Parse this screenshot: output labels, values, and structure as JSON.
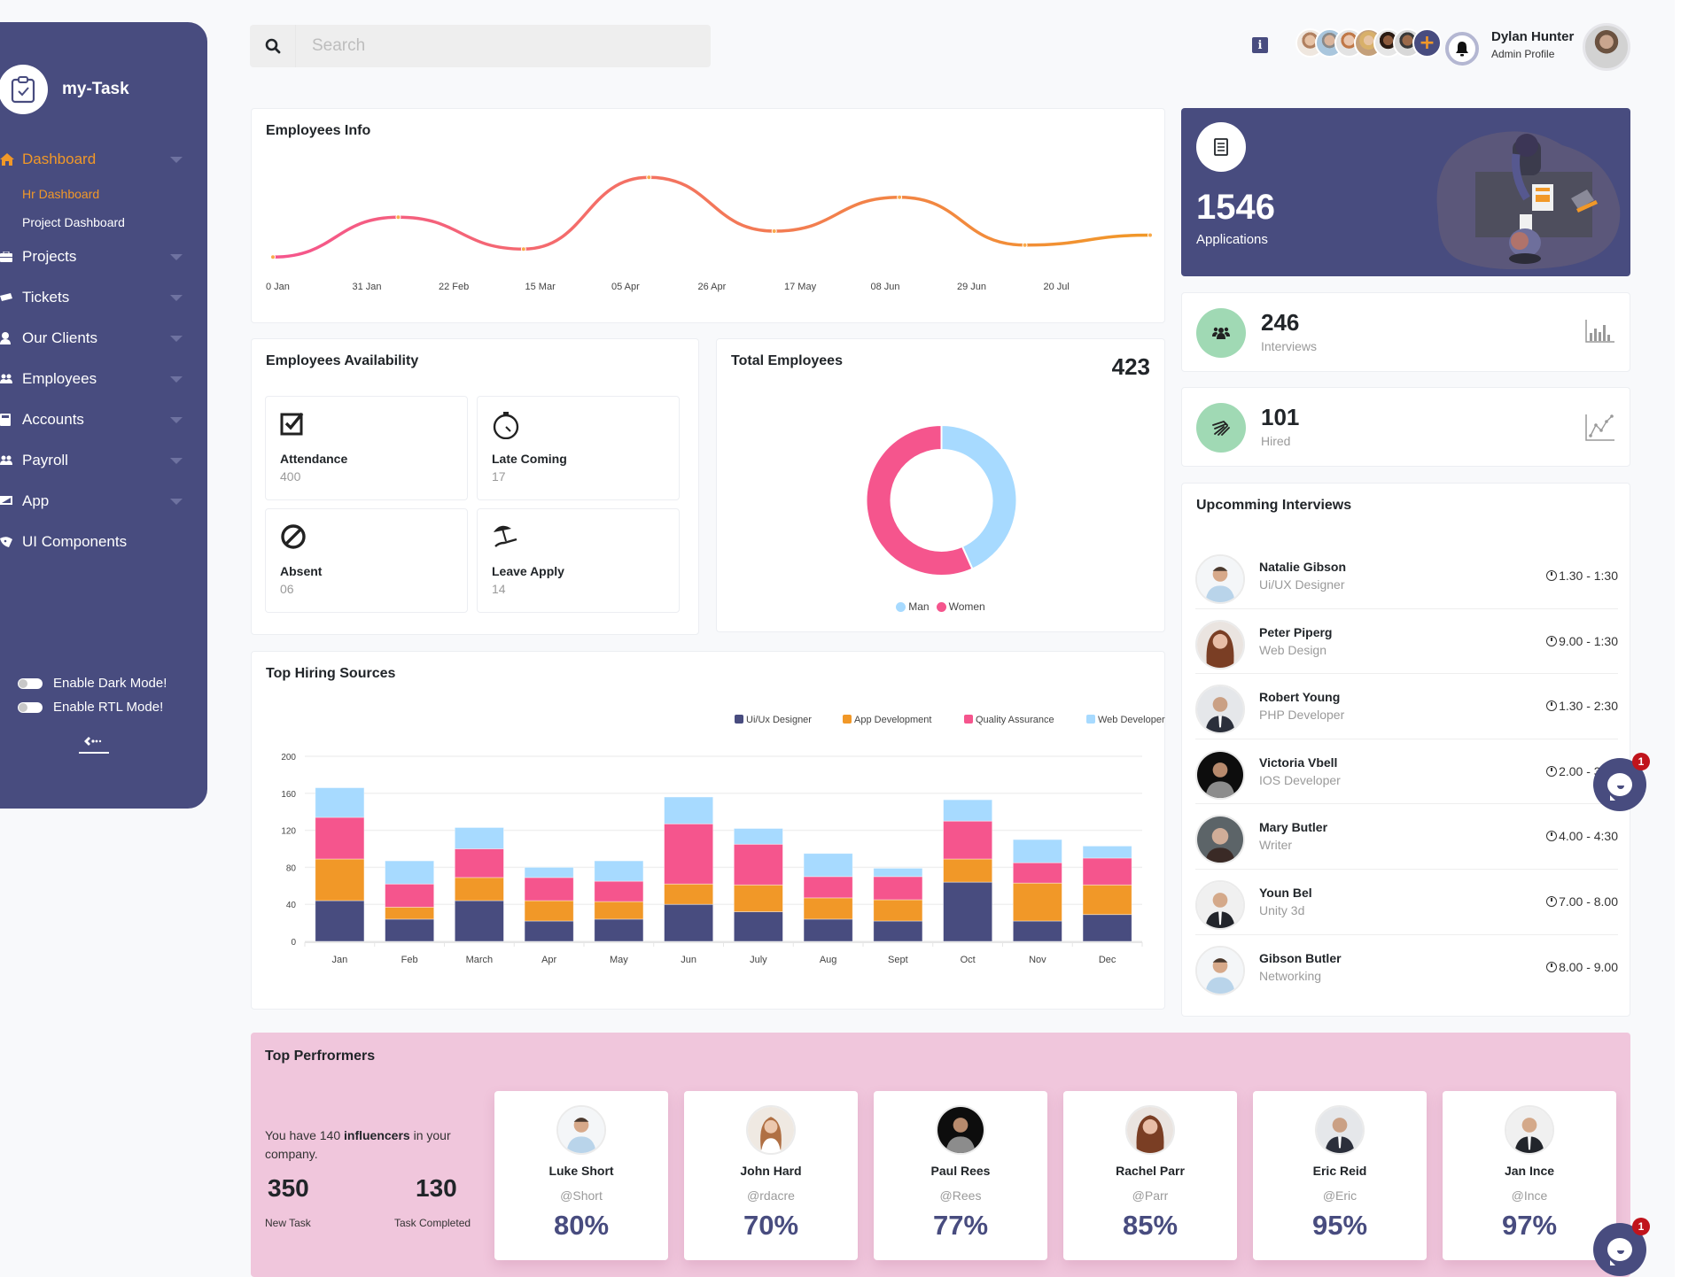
{
  "colors": {
    "primary": "#484c7f",
    "accent": "#f19828",
    "pink": "#f1c6dc",
    "green_circle": "#a0d9b4",
    "series": [
      "#484c7f",
      "#f19828",
      "#f5558d",
      "#a7daff"
    ]
  },
  "sidebar": {
    "brand": "my-Task",
    "brand_icon": "clipboard-check-icon",
    "menu": [
      {
        "label": "Dashboard",
        "icon": "home-icon",
        "active": true,
        "expandable": true,
        "children": [
          {
            "label": "Hr Dashboard",
            "active": true
          },
          {
            "label": "Project Dashboard",
            "active": false
          }
        ]
      },
      {
        "label": "Projects",
        "icon": "briefcase-icon",
        "expandable": true
      },
      {
        "label": "Tickets",
        "icon": "ticket-icon",
        "expandable": true
      },
      {
        "label": "Our Clients",
        "icon": "user-icon",
        "expandable": true
      },
      {
        "label": "Employees",
        "icon": "users-icon",
        "expandable": true
      },
      {
        "label": "Accounts",
        "icon": "calculator-icon",
        "expandable": true
      },
      {
        "label": "Payroll",
        "icon": "users-icon",
        "expandable": true
      },
      {
        "label": "App",
        "icon": "app-icon",
        "expandable": true
      },
      {
        "label": "UI Components",
        "icon": "palette-icon",
        "expandable": false
      }
    ],
    "toggles": [
      {
        "label": "Enable Dark Mode!",
        "on": false
      },
      {
        "label": "Enable RTL Mode!",
        "on": false
      }
    ],
    "collapse_icon": "arrow-left-icon"
  },
  "header": {
    "search": {
      "placeholder": "Search",
      "value": ""
    },
    "info_label": "i",
    "team_avatars": 6,
    "add_member_label": "+",
    "user": {
      "name": "Dylan Hunter",
      "role": "Admin Profile"
    }
  },
  "employees_info": {
    "title": "Employees Info"
  },
  "applications": {
    "value": "1546",
    "label": "Applications"
  },
  "stats": [
    {
      "value": "246",
      "label": "Interviews",
      "icon": "users-icon",
      "trend_icon": "bar-chart-icon"
    },
    {
      "value": "101",
      "label": "Hired",
      "icon": "handshake-icon",
      "trend_icon": "line-chart-icon"
    }
  ],
  "availability": {
    "title": "Employees Availability",
    "tiles": [
      {
        "label": "Attendance",
        "value": "400",
        "icon": "checkbox-icon"
      },
      {
        "label": "Late Coming",
        "value": "17",
        "icon": "stopwatch-icon"
      },
      {
        "label": "Absent",
        "value": "06",
        "icon": "ban-icon"
      },
      {
        "label": "Leave Apply",
        "value": "14",
        "icon": "beach-umbrella-icon"
      }
    ]
  },
  "total_employees": {
    "title": "Total Employees",
    "value": "423"
  },
  "top_hiring": {
    "title": "Top Hiring Sources"
  },
  "upcoming": {
    "title": "Upcomming Interviews",
    "items": [
      {
        "name": "Natalie Gibson",
        "role": "Ui/UX Designer",
        "time": "1.30 - 1:30"
      },
      {
        "name": "Peter Piperg",
        "role": "Web Design",
        "time": "9.00 - 1:30"
      },
      {
        "name": "Robert Young",
        "role": "PHP Developer",
        "time": "1.30 - 2:30"
      },
      {
        "name": "Victoria Vbell",
        "role": "IOS Developer",
        "time": "2.00 - 3:30"
      },
      {
        "name": "Mary Butler",
        "role": "Writer",
        "time": "4.00 - 4:30"
      },
      {
        "name": "Youn Bel",
        "role": "Unity 3d",
        "time": "7.00 - 8.00"
      },
      {
        "name": "Gibson Butler",
        "role": "Networking",
        "time": "8.00 - 9.00"
      }
    ]
  },
  "performers": {
    "title": "Top Perfrormers",
    "text_prefix": "You have 140 ",
    "text_bold": "influencers",
    "text_suffix": " in your company.",
    "new_task_value": "350",
    "new_task_label": "New Task",
    "completed_value": "130",
    "completed_label": "Task Completed",
    "people": [
      {
        "name": "Luke Short",
        "handle": "@Short",
        "pct": "80%"
      },
      {
        "name": "John Hard",
        "handle": "@rdacre",
        "pct": "70%"
      },
      {
        "name": "Paul Rees",
        "handle": "@Rees",
        "pct": "77%"
      },
      {
        "name": "Rachel Parr",
        "handle": "@Parr",
        "pct": "85%"
      },
      {
        "name": "Eric Reid",
        "handle": "@Eric",
        "pct": "95%"
      },
      {
        "name": "Jan Ince",
        "handle": "@Ince",
        "pct": "97%"
      }
    ]
  },
  "chat": {
    "badge": "1"
  },
  "chart_data": [
    {
      "type": "line",
      "title": "Employees Info",
      "x_tick_labels": [
        "0 Jan",
        "31 Jan",
        "22 Feb",
        "15 Mar",
        "05 Apr",
        "26 Apr",
        "17 May",
        "08 Jun",
        "29 Jun",
        "20 Jul"
      ],
      "values": [
        19,
        39,
        23,
        59,
        32,
        49,
        25,
        30
      ],
      "yaxis_visible": false,
      "gradient": [
        "#f5558d",
        "#f19828"
      ],
      "grid": false
    },
    {
      "type": "pie",
      "title": "Total Employees",
      "donut": true,
      "labels": [
        "Man",
        "Women"
      ],
      "values": [
        183,
        240
      ],
      "colors": [
        "#a7daff",
        "#f5558d"
      ],
      "legend": "bottom"
    },
    {
      "type": "bar",
      "stacked": true,
      "title": "Top Hiring Sources",
      "categories": [
        "Jan",
        "Feb",
        "March",
        "Apr",
        "May",
        "Jun",
        "July",
        "Aug",
        "Sept",
        "Oct",
        "Nov",
        "Dec"
      ],
      "series": [
        {
          "name": "Ui/Ux Designer",
          "values": [
            44,
            24,
            44,
            22,
            24,
            40,
            32,
            24,
            22,
            64,
            22,
            29
          ]
        },
        {
          "name": "App Development",
          "values": [
            45,
            13,
            25,
            22,
            19,
            22,
            29,
            23,
            23,
            25,
            41,
            32
          ]
        },
        {
          "name": "Quality Assurance",
          "values": [
            45,
            25,
            31,
            25,
            22,
            65,
            44,
            23,
            25,
            41,
            22,
            29
          ]
        },
        {
          "name": "Web Developer",
          "values": [
            32,
            25,
            23,
            11,
            22,
            29,
            17,
            25,
            9,
            23,
            25,
            13
          ]
        }
      ],
      "ylim": [
        0,
        200
      ],
      "y_ticks": [
        0,
        40,
        80,
        120,
        160,
        200
      ],
      "legend": "top-right",
      "grid": true
    }
  ]
}
